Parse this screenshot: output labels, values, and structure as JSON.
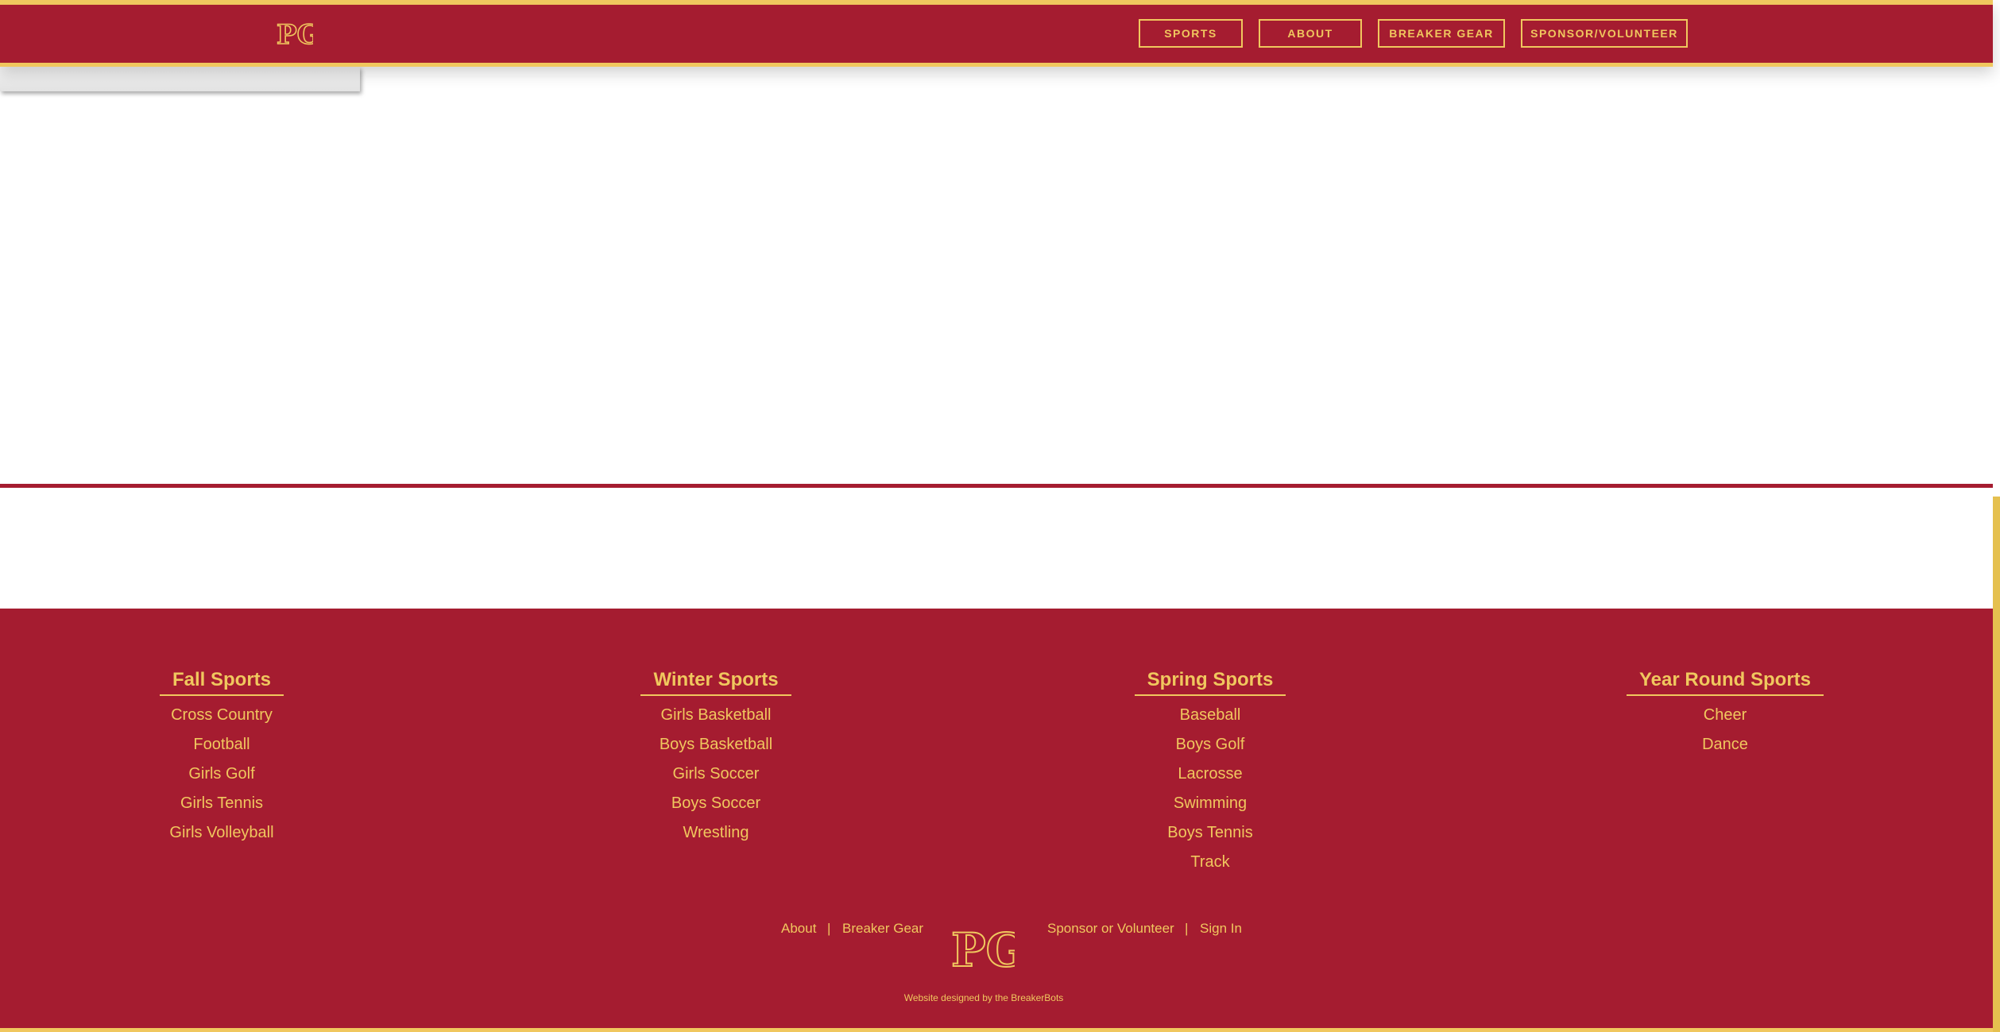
{
  "header": {
    "logo_text": "PG",
    "nav": [
      {
        "label": "SPORTS"
      },
      {
        "label": "ABOUT"
      },
      {
        "label": "BREAKER GEAR"
      },
      {
        "label": "SPONSOR/VOLUNTEER"
      }
    ]
  },
  "footer": {
    "columns": [
      {
        "title": "Fall Sports",
        "items": [
          "Cross Country",
          "Football",
          "Girls Golf",
          "Girls Tennis",
          "Girls Volleyball"
        ]
      },
      {
        "title": "Winter Sports",
        "items": [
          "Girls Basketball",
          "Boys Basketball",
          "Girls Soccer",
          "Boys Soccer",
          "Wrestling"
        ]
      },
      {
        "title": "Spring Sports",
        "items": [
          "Baseball",
          "Boys Golf",
          "Lacrosse",
          "Swimming",
          "Boys Tennis",
          "Track"
        ]
      },
      {
        "title": "Year Round Sports",
        "items": [
          "Cheer",
          "Dance"
        ]
      }
    ],
    "links": {
      "about": "About",
      "separator": "|",
      "breaker_gear": "Breaker Gear",
      "sponsor": "Sponsor or Volunteer",
      "sign_in": "Sign In"
    },
    "logo_text": "PG",
    "credit": "Website designed by the BreakerBots"
  },
  "colors": {
    "brand_red": "#a51c30",
    "brand_gold": "#f0c75e"
  }
}
